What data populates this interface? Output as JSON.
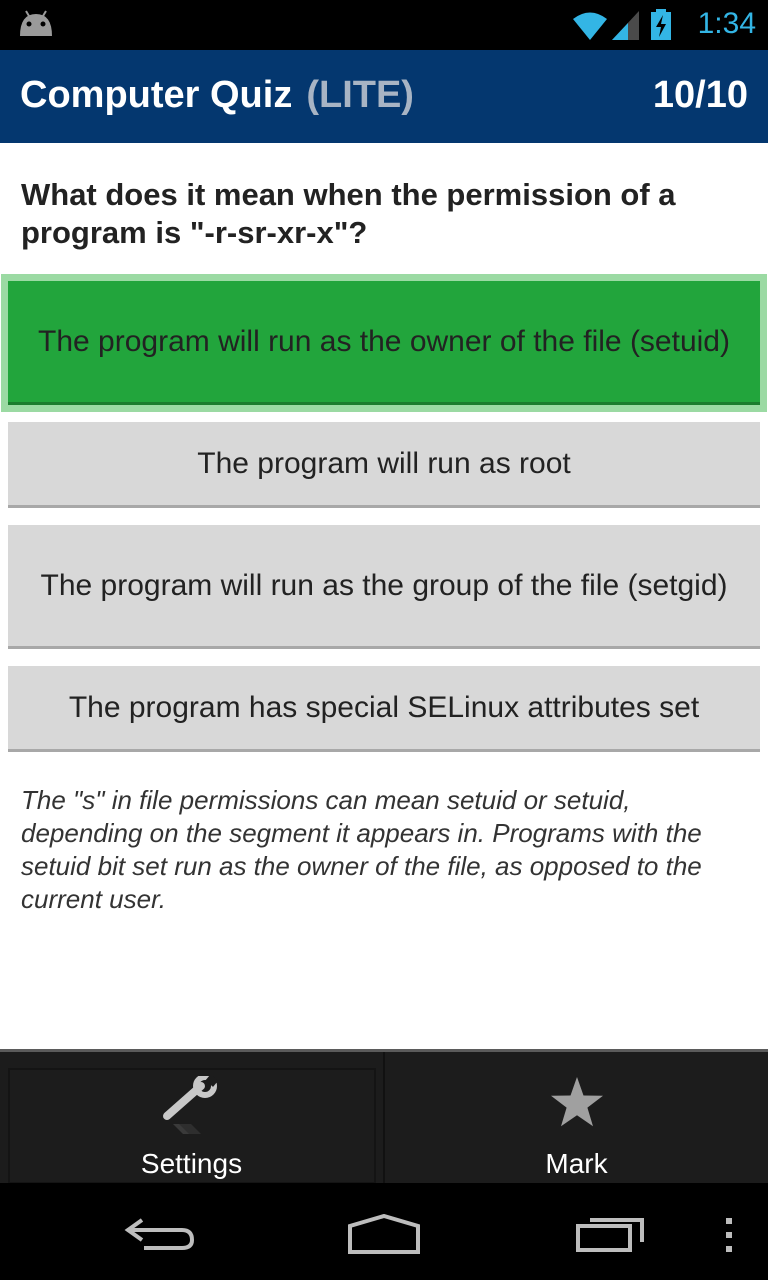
{
  "status_bar": {
    "time": "1:34",
    "icons": [
      "android-icon",
      "wifi-icon",
      "signal-icon",
      "battery-charging-icon"
    ]
  },
  "app_bar": {
    "title": "Computer Quiz",
    "edition": "(LITE)",
    "progress": "10/10",
    "color": "#04376f"
  },
  "question": {
    "text": "What does it mean when the permission of a program is \"-r-sr-xr-x\"?"
  },
  "answers": [
    {
      "label": "The program will run as the owner of the file (setuid)",
      "state": "correct",
      "color": "#22a53c"
    },
    {
      "label": "The program will run as root",
      "state": "default",
      "color": "#d8d8d8"
    },
    {
      "label": "The program will run as the group of the file (setgid)",
      "state": "default",
      "color": "#d8d8d8"
    },
    {
      "label": "The program has special SELinux attributes set",
      "state": "default",
      "color": "#d8d8d8"
    }
  ],
  "explanation": {
    "text": "The \"s\" in file permissions can mean setuid or setuid, depending on the segment it appears in. Programs with the setuid bit set run as the owner of the file, as opposed to the current user."
  },
  "bottom_bar": {
    "settings_label": "Settings",
    "settings_icon": "wrench-icon",
    "mark_label": "Mark",
    "mark_icon": "star-icon"
  },
  "nav_bar": {
    "icons": [
      "back-icon",
      "home-icon",
      "recent-apps-icon",
      "menu-icon"
    ]
  }
}
